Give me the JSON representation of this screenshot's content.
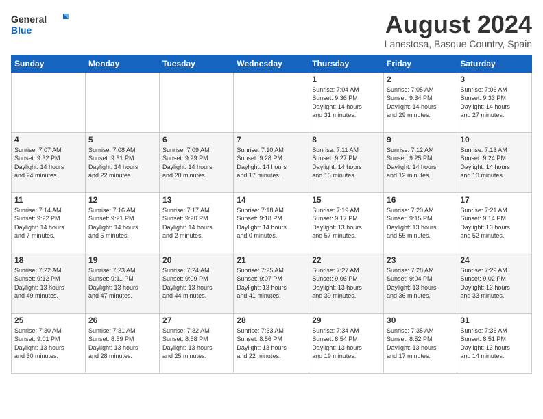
{
  "header": {
    "logo_general": "General",
    "logo_blue": "Blue",
    "month_title": "August 2024",
    "subtitle": "Lanestosa, Basque Country, Spain"
  },
  "weekdays": [
    "Sunday",
    "Monday",
    "Tuesday",
    "Wednesday",
    "Thursday",
    "Friday",
    "Saturday"
  ],
  "weeks": [
    [
      {
        "day": "",
        "info": ""
      },
      {
        "day": "",
        "info": ""
      },
      {
        "day": "",
        "info": ""
      },
      {
        "day": "",
        "info": ""
      },
      {
        "day": "1",
        "info": "Sunrise: 7:04 AM\nSunset: 9:36 PM\nDaylight: 14 hours\nand 31 minutes."
      },
      {
        "day": "2",
        "info": "Sunrise: 7:05 AM\nSunset: 9:34 PM\nDaylight: 14 hours\nand 29 minutes."
      },
      {
        "day": "3",
        "info": "Sunrise: 7:06 AM\nSunset: 9:33 PM\nDaylight: 14 hours\nand 27 minutes."
      }
    ],
    [
      {
        "day": "4",
        "info": "Sunrise: 7:07 AM\nSunset: 9:32 PM\nDaylight: 14 hours\nand 24 minutes."
      },
      {
        "day": "5",
        "info": "Sunrise: 7:08 AM\nSunset: 9:31 PM\nDaylight: 14 hours\nand 22 minutes."
      },
      {
        "day": "6",
        "info": "Sunrise: 7:09 AM\nSunset: 9:29 PM\nDaylight: 14 hours\nand 20 minutes."
      },
      {
        "day": "7",
        "info": "Sunrise: 7:10 AM\nSunset: 9:28 PM\nDaylight: 14 hours\nand 17 minutes."
      },
      {
        "day": "8",
        "info": "Sunrise: 7:11 AM\nSunset: 9:27 PM\nDaylight: 14 hours\nand 15 minutes."
      },
      {
        "day": "9",
        "info": "Sunrise: 7:12 AM\nSunset: 9:25 PM\nDaylight: 14 hours\nand 12 minutes."
      },
      {
        "day": "10",
        "info": "Sunrise: 7:13 AM\nSunset: 9:24 PM\nDaylight: 14 hours\nand 10 minutes."
      }
    ],
    [
      {
        "day": "11",
        "info": "Sunrise: 7:14 AM\nSunset: 9:22 PM\nDaylight: 14 hours\nand 7 minutes."
      },
      {
        "day": "12",
        "info": "Sunrise: 7:16 AM\nSunset: 9:21 PM\nDaylight: 14 hours\nand 5 minutes."
      },
      {
        "day": "13",
        "info": "Sunrise: 7:17 AM\nSunset: 9:20 PM\nDaylight: 14 hours\nand 2 minutes."
      },
      {
        "day": "14",
        "info": "Sunrise: 7:18 AM\nSunset: 9:18 PM\nDaylight: 14 hours\nand 0 minutes."
      },
      {
        "day": "15",
        "info": "Sunrise: 7:19 AM\nSunset: 9:17 PM\nDaylight: 13 hours\nand 57 minutes."
      },
      {
        "day": "16",
        "info": "Sunrise: 7:20 AM\nSunset: 9:15 PM\nDaylight: 13 hours\nand 55 minutes."
      },
      {
        "day": "17",
        "info": "Sunrise: 7:21 AM\nSunset: 9:14 PM\nDaylight: 13 hours\nand 52 minutes."
      }
    ],
    [
      {
        "day": "18",
        "info": "Sunrise: 7:22 AM\nSunset: 9:12 PM\nDaylight: 13 hours\nand 49 minutes."
      },
      {
        "day": "19",
        "info": "Sunrise: 7:23 AM\nSunset: 9:11 PM\nDaylight: 13 hours\nand 47 minutes."
      },
      {
        "day": "20",
        "info": "Sunrise: 7:24 AM\nSunset: 9:09 PM\nDaylight: 13 hours\nand 44 minutes."
      },
      {
        "day": "21",
        "info": "Sunrise: 7:25 AM\nSunset: 9:07 PM\nDaylight: 13 hours\nand 41 minutes."
      },
      {
        "day": "22",
        "info": "Sunrise: 7:27 AM\nSunset: 9:06 PM\nDaylight: 13 hours\nand 39 minutes."
      },
      {
        "day": "23",
        "info": "Sunrise: 7:28 AM\nSunset: 9:04 PM\nDaylight: 13 hours\nand 36 minutes."
      },
      {
        "day": "24",
        "info": "Sunrise: 7:29 AM\nSunset: 9:02 PM\nDaylight: 13 hours\nand 33 minutes."
      }
    ],
    [
      {
        "day": "25",
        "info": "Sunrise: 7:30 AM\nSunset: 9:01 PM\nDaylight: 13 hours\nand 30 minutes."
      },
      {
        "day": "26",
        "info": "Sunrise: 7:31 AM\nSunset: 8:59 PM\nDaylight: 13 hours\nand 28 minutes."
      },
      {
        "day": "27",
        "info": "Sunrise: 7:32 AM\nSunset: 8:58 PM\nDaylight: 13 hours\nand 25 minutes."
      },
      {
        "day": "28",
        "info": "Sunrise: 7:33 AM\nSunset: 8:56 PM\nDaylight: 13 hours\nand 22 minutes."
      },
      {
        "day": "29",
        "info": "Sunrise: 7:34 AM\nSunset: 8:54 PM\nDaylight: 13 hours\nand 19 minutes."
      },
      {
        "day": "30",
        "info": "Sunrise: 7:35 AM\nSunset: 8:52 PM\nDaylight: 13 hours\nand 17 minutes."
      },
      {
        "day": "31",
        "info": "Sunrise: 7:36 AM\nSunset: 8:51 PM\nDaylight: 13 hours\nand 14 minutes."
      }
    ]
  ]
}
